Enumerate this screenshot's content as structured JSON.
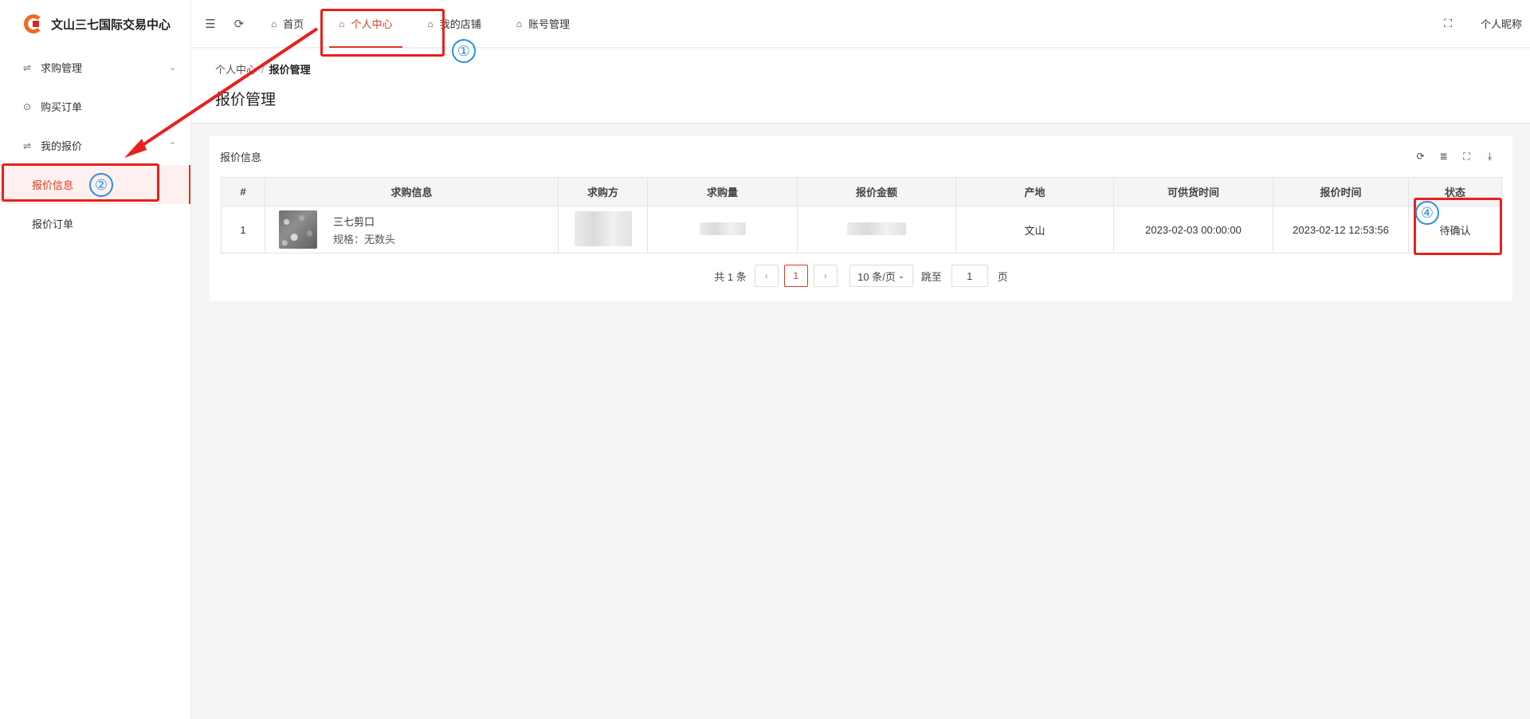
{
  "app": {
    "name": "文山三七国际交易中心"
  },
  "sidebar": {
    "items": [
      {
        "label": "求购管理",
        "icon": "sliders-icon",
        "chevron": "⌄"
      },
      {
        "label": "购买订单",
        "icon": "clock-icon"
      },
      {
        "label": "我的报价",
        "icon": "sliders-icon",
        "chevron": "⌃"
      }
    ],
    "subitems": [
      {
        "label": "报价信息"
      },
      {
        "label": "报价订单"
      }
    ]
  },
  "topbar": {
    "tabs": [
      {
        "label": "首页"
      },
      {
        "label": "个人中心"
      },
      {
        "label": "我的店铺"
      },
      {
        "label": "账号管理"
      }
    ],
    "nickname": "个人昵称"
  },
  "breadcrumb": {
    "parent": "个人中心",
    "current": "报价管理"
  },
  "page_title": "报价管理",
  "card": {
    "title": "报价信息"
  },
  "table": {
    "headers": [
      "#",
      "求购信息",
      "求购方",
      "求购量",
      "报价金额",
      "产地",
      "可供货时间",
      "报价时间",
      "状态"
    ],
    "rows": [
      {
        "index": "1",
        "product_name": "三七剪口",
        "product_spec": "规格：无数头",
        "origin": "文山",
        "supply_time": "2023-02-03 00:00:00",
        "quote_time": "2023-02-12 12:53:56",
        "status": "待确认"
      }
    ]
  },
  "pagination": {
    "total_text": "共 1 条",
    "current_page": "1",
    "page_size": "10 条/页",
    "goto_label": "跳至",
    "goto_value": "1",
    "page_suffix": "页"
  },
  "annotations": [
    "①",
    "②",
    "④"
  ],
  "colors": {
    "accent": "#d73c24",
    "annotation_red": "#e8201c",
    "annotation_blue": "#2b8fe0"
  }
}
